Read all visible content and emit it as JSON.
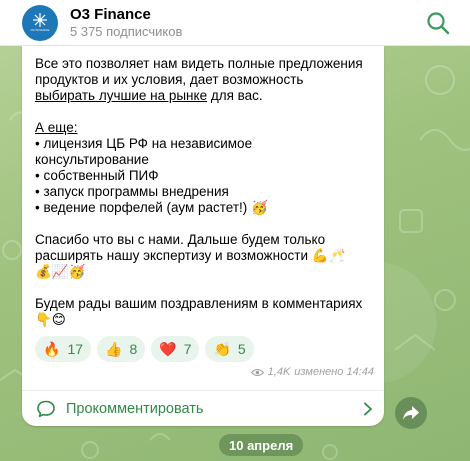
{
  "header": {
    "channel_name": "O3 Finance",
    "subscribers": "5 375 подписчиков",
    "avatar_text": "O3 FINANCE"
  },
  "message": {
    "p1_line1": "Все это позволяет нам видеть полные предложения",
    "p1_line2": "продуктов и их условия, дает возможность",
    "p1_link": "выбирать лучшие на рынке",
    "p1_tail": " для вас.",
    "p2_heading": "А еще:",
    "p2_items": [
      "• лицензия ЦБ РФ на независимое",
      "консультирование",
      "• собственный ПИФ",
      "• запуск программы внедрения",
      "• ведение порфелей (аум растет!)  🥳"
    ],
    "p3_line1": "Спасибо что вы с нами. Дальше будем только",
    "p3_line2": "расширять нашу экспертизу и возможности 💪🥂",
    "p3_line3": "💰📈🥳",
    "p4_line1": "Будем рады вашим поздравлениям в комментариях",
    "p4_line2": "👇😊"
  },
  "reactions": [
    {
      "emoji": "🔥",
      "count": "17"
    },
    {
      "emoji": "👍",
      "count": "8"
    },
    {
      "emoji": "❤️",
      "count": "7"
    },
    {
      "emoji": "👏",
      "count": "5"
    }
  ],
  "meta": {
    "views": "1,4K",
    "edited_time": "изменено 14:44"
  },
  "comments": {
    "label": "Прокомментировать"
  },
  "date_label": "10 апреля",
  "icons": {
    "search": "search-icon",
    "eye": "eye-icon",
    "comment": "comment-bubble-icon",
    "chevron": "chevron-right-icon",
    "share": "share-arrow-icon"
  },
  "colors": {
    "accent_green": "#2e8a46",
    "avatar_blue": "#1e78b8",
    "reaction_bg": "#e8f4ec"
  }
}
